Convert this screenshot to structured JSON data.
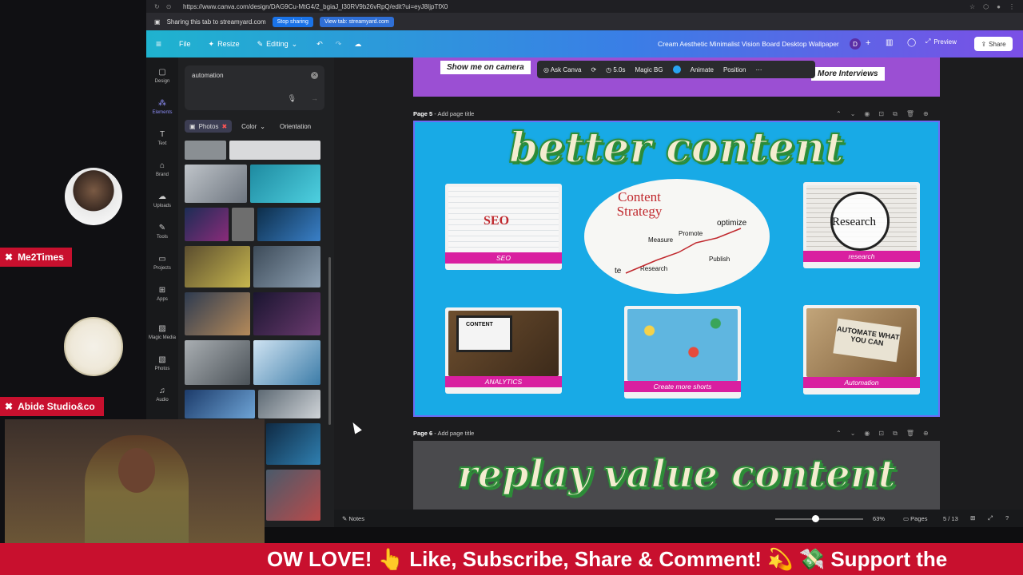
{
  "browser": {
    "url": "https://www.canva.com/design/DAG9Cu-MtG4/2_bgiaJ_l30RV9b26vRpQ/edit?ui=eyJ8IjpTfX0"
  },
  "sharing": {
    "text": "Sharing this tab to streamyard.com",
    "stop_label": "Stop sharing",
    "view_label": "View tab: streamyard.com"
  },
  "canva_header": {
    "file_label": "File",
    "resize_label": "Resize",
    "editing_label": "Editing",
    "doc_title": "Cream Aesthetic Minimalist Vision Board Desktop Wallpaper",
    "avatar_initial": "D",
    "preview_label": "Preview",
    "share_label": "Share"
  },
  "tool_rail": {
    "items": [
      {
        "label": "Design",
        "icon": "design-icon"
      },
      {
        "label": "Elements",
        "icon": "elements-icon"
      },
      {
        "label": "Text",
        "icon": "text-icon"
      },
      {
        "label": "Brand",
        "icon": "brand-icon"
      },
      {
        "label": "Uploads",
        "icon": "uploads-icon"
      },
      {
        "label": "Tools",
        "icon": "tools-icon"
      },
      {
        "label": "Projects",
        "icon": "projects-icon"
      },
      {
        "label": "Apps",
        "icon": "apps-icon"
      },
      {
        "label": "Magic Media",
        "icon": "magic-media-icon"
      },
      {
        "label": "Photos",
        "icon": "photos-icon"
      },
      {
        "label": "Audio",
        "icon": "audio-icon"
      }
    ]
  },
  "side_panel": {
    "search_value": "automation",
    "chips": {
      "photos": "Photos",
      "color": "Color",
      "orientation": "Orientation"
    }
  },
  "stream": {
    "guest1_name": "Me2Times",
    "guest2_name": "Abide Studio&co",
    "ticker": "OW LOVE! 👆 Like, Subscribe, Share & Comment! 💫 💸 Support the"
  },
  "context_toolbar": {
    "ask_canva": "Ask Canva",
    "duration": "5.0s",
    "magic_bg": "Magic BG",
    "animate": "Animate",
    "position": "Position"
  },
  "prev_page": {
    "pill_left": "Show me on camera",
    "pill_right": "More Interviews"
  },
  "page5": {
    "label": "Page 5",
    "add_title": "Add page title",
    "title": "better content",
    "cards": {
      "seo": "SEO",
      "seo_img": "SEO",
      "research": "research",
      "research_img": "Research",
      "analytics": "ANALYTICS",
      "analytics_img": "CONTENT",
      "shorts": "Create more shorts",
      "automation": "Automation",
      "automation_img": "AUTOMATE WHAT YOU CAN"
    },
    "strategy": {
      "heading": "Content Strategy",
      "optimize": "optimize",
      "promote": "Promote",
      "measure": "Measure",
      "publish": "Publish",
      "research": "Research",
      "create": "te"
    }
  },
  "page6": {
    "label": "Page 6",
    "add_title": "Add page title",
    "title": "replay value content"
  },
  "bottom_bar": {
    "notes": "Notes",
    "zoom": "63%",
    "pages": "Pages",
    "page_count": "5 / 13"
  }
}
